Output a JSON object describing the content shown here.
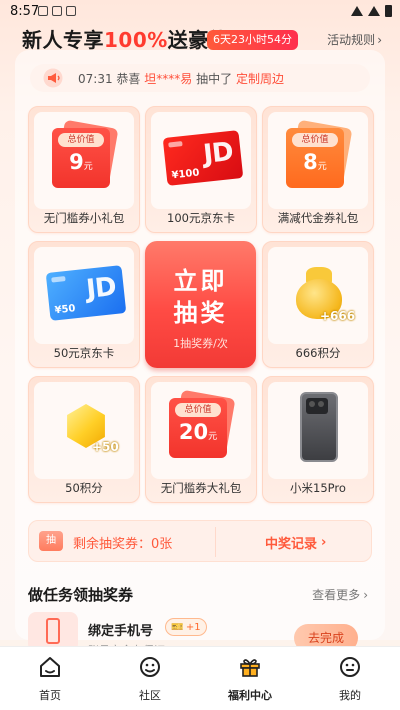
{
  "status_bar": {
    "time": "8:57"
  },
  "header": {
    "title_pre": "新人专享",
    "title_highlight": "100%",
    "title_post": "送豪礼",
    "countdown": "6天23小时54分",
    "rules_label": "活动规则",
    "rules_arrow": "›"
  },
  "marquee": {
    "time": "07:31",
    "text_pre": "恭喜",
    "user": "坦****易",
    "text_mid": "抽中了",
    "prize": "定制周边"
  },
  "prizes": [
    {
      "label": "无门槛券小礼包",
      "tag": "总价值",
      "value": "9",
      "unit": "元"
    },
    {
      "label": "100元京东卡",
      "card_value": "¥100",
      "card_logo": "JD"
    },
    {
      "label": "满减代金券礼包",
      "tag": "总价值",
      "value": "8",
      "unit": "元"
    },
    {
      "label": "50元京东卡",
      "card_value": "¥50",
      "card_logo": "JD"
    },
    {
      "label": "666积分",
      "badge": "+666"
    },
    {
      "label": "50积分",
      "badge": "+50"
    },
    {
      "label": "无门槛券大礼包",
      "tag": "总价值",
      "value": "20",
      "unit": "元"
    },
    {
      "label": "小米15Pro"
    }
  ],
  "draw_button": {
    "line1": "立即",
    "line2": "抽奖",
    "cost": "1抽奖券/次"
  },
  "summary": {
    "ticket_icon_text": "抽",
    "remaining": "剩余抽奖券：0张",
    "records_label": "中奖记录",
    "records_arrow": "›"
  },
  "tasks": {
    "title": "做任务领抽奖券",
    "more_label": "查看更多",
    "more_arrow": "›",
    "items": [
      {
        "name": "绑定手机号",
        "reward": "+1",
        "subtitle": "账号安全有保证",
        "button": "去完成"
      }
    ]
  },
  "tabbar": [
    {
      "label": "首页",
      "icon": "home-icon"
    },
    {
      "label": "社区",
      "icon": "community-icon"
    },
    {
      "label": "福利中心",
      "icon": "gift-icon",
      "active": true
    },
    {
      "label": "我的",
      "icon": "profile-icon"
    }
  ],
  "colors": {
    "accent": "#ff4f3a",
    "brand_red": "#f2342c"
  }
}
